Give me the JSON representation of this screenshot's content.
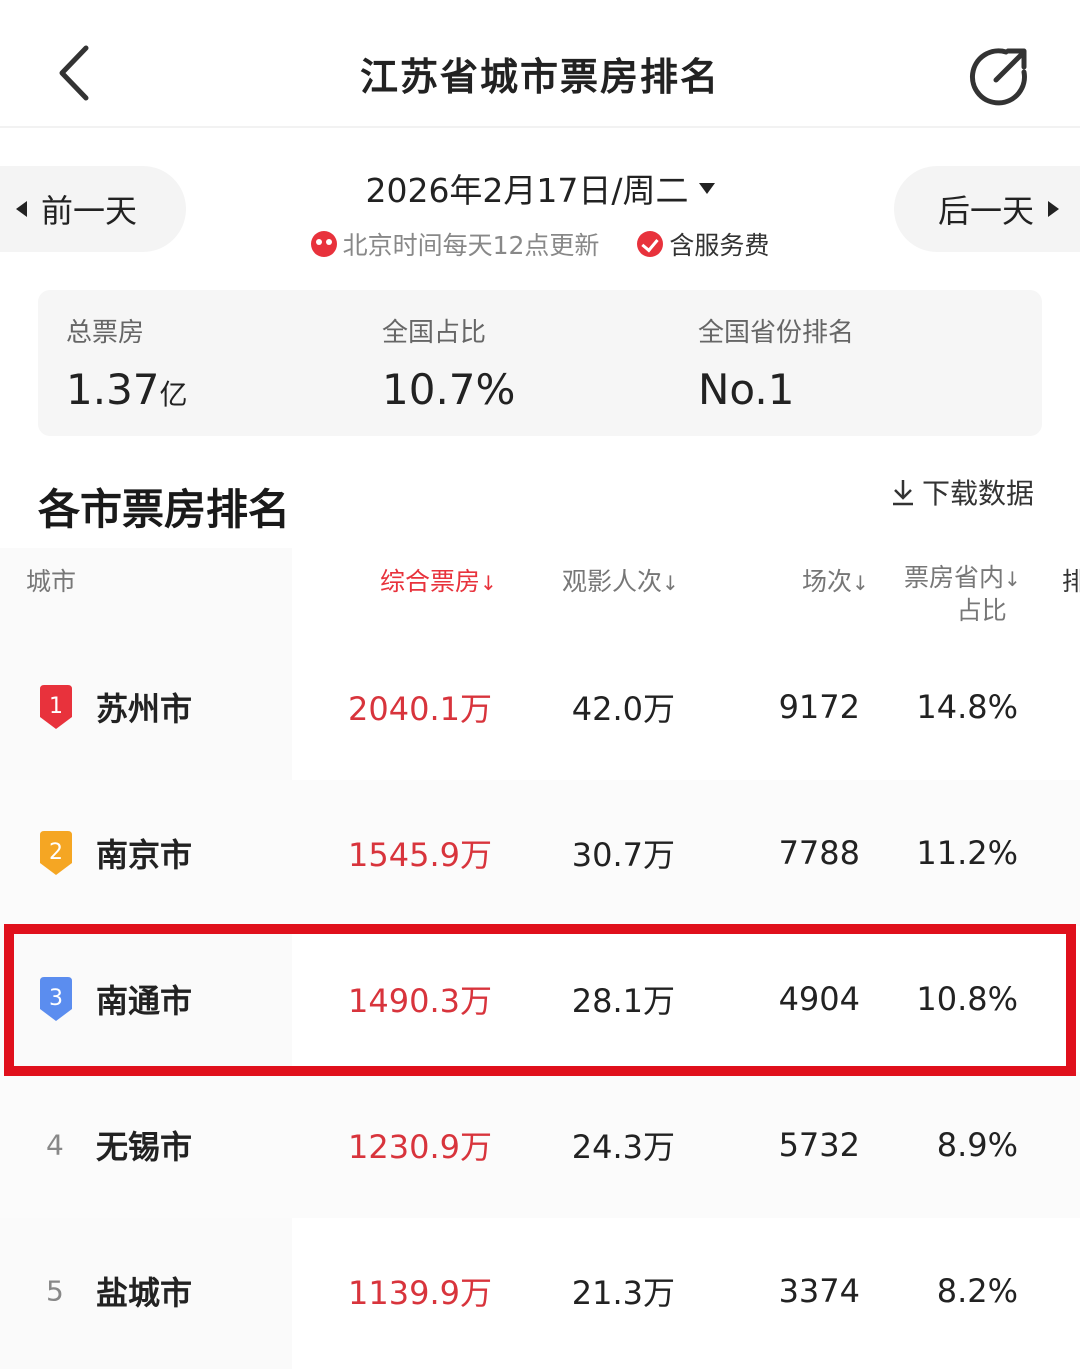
{
  "nav": {
    "title": "江苏省城市票房排名",
    "back_icon": "chevron-left-icon",
    "share_icon": "share-icon"
  },
  "date_nav": {
    "prev_label": "前一天",
    "next_label": "后一天",
    "date": "2026年2月17日/周二",
    "update_note": "北京时间每天12点更新",
    "fee_note": "含服务费"
  },
  "summary": {
    "total": {
      "label": "总票房",
      "value": "1.37",
      "unit": "亿"
    },
    "share": {
      "label": "全国占比",
      "value": "10.7%"
    },
    "rank": {
      "label": "全国省份排名",
      "value": "No.1"
    }
  },
  "section": {
    "title": "各市票房排名",
    "download_label": "下载数据"
  },
  "table": {
    "headers": {
      "city": "城市",
      "box": "综合票房",
      "audience": "观影人次",
      "shows": "场次",
      "pct_line1": "票房省内",
      "pct_line2": "占比",
      "extra": "排"
    },
    "rows": [
      {
        "rank": "1",
        "city": "苏州市",
        "box": "2040.1万",
        "audience": "42.0万",
        "shows": "9172",
        "pct": "14.8%"
      },
      {
        "rank": "2",
        "city": "南京市",
        "box": "1545.9万",
        "audience": "30.7万",
        "shows": "7788",
        "pct": "11.2%"
      },
      {
        "rank": "3",
        "city": "南通市",
        "box": "1490.3万",
        "audience": "28.1万",
        "shows": "4904",
        "pct": "10.8%"
      },
      {
        "rank": "4",
        "city": "无锡市",
        "box": "1230.9万",
        "audience": "24.3万",
        "shows": "5732",
        "pct": "8.9%"
      },
      {
        "rank": "5",
        "city": "盐城市",
        "box": "1139.9万",
        "audience": "21.3万",
        "shows": "3374",
        "pct": "8.2%"
      }
    ]
  },
  "colors": {
    "accent_red": "#e8323c",
    "highlight_red": "#e0101c",
    "rank1": "#e8323c",
    "rank2": "#f5a623",
    "rank3": "#5b8def"
  }
}
